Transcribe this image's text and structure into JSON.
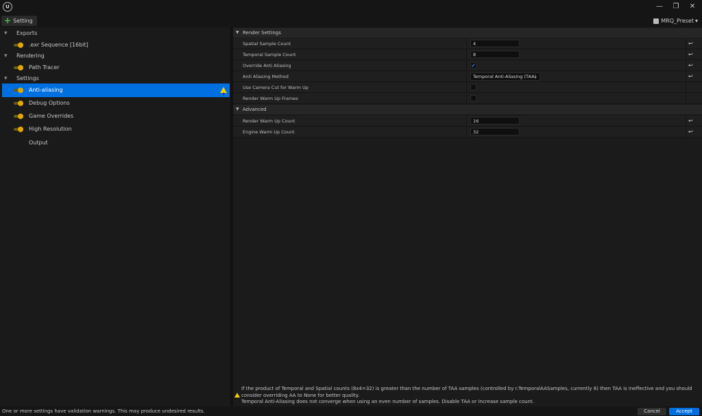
{
  "window": {
    "logo_text": "U",
    "minimize": "—",
    "restore": "❐",
    "close": "✕"
  },
  "toolbar": {
    "add_setting_label": "Setting",
    "preset_label": "MRQ_Preset",
    "preset_arrow": "▾"
  },
  "tree": {
    "exports_label": "Exports",
    "exr_label": ".exr Sequence [16bit]",
    "rendering_label": "Rendering",
    "path_tracer_label": "Path Tracer",
    "settings_label": "Settings",
    "anti_aliasing_label": "Anti-aliasing",
    "debug_options_label": "Debug Options",
    "game_overrides_label": "Game Overrides",
    "high_resolution_label": "High Resolution",
    "output_label": "Output",
    "warning_mark": "!"
  },
  "details": {
    "render_settings_header": "Render Settings",
    "spatial_sample_count_label": "Spatial Sample Count",
    "spatial_sample_count_value": "4",
    "temporal_sample_count_label": "Temporal Sample Count",
    "temporal_sample_count_value": "8",
    "override_aa_label": "Override Anti Aliasing",
    "override_aa_check": "✔",
    "aa_method_label": "Anti Aliasing Method",
    "aa_method_value": "Temporal Anti-Aliasing (TAA)",
    "dropdown_arrow": "⌄",
    "use_camera_cut_label": "Use Camera Cut for Warm Up",
    "render_warmup_frames_label": "Render Warm Up Frames",
    "advanced_header": "Advanced",
    "render_warmup_count_label": "Render Warm Up Count",
    "render_warmup_count_value": "16",
    "engine_warmup_count_label": "Engine Warm Up Count",
    "engine_warmup_count_value": "32",
    "reset_glyph": "↩",
    "caret_glyph": "▼"
  },
  "warning": {
    "line1": "If the product of Temporal and Spatial counts (8x4=32) is greater than the number of TAA samples (controlled by r.TemporalAASamples, currently 8) then TAA is ineffective and you should consider overriding AA to None for better quality.",
    "line2": "Temporal Anti-Aliasing does not converge when using an even number of samples. Disable TAA or increase sample count."
  },
  "status": {
    "message": "One or more settings have validation warnings. This may produce undesired results.",
    "cancel_label": "Cancel",
    "accept_label": "Accept"
  },
  "colors": {
    "accent": "#0070e0",
    "toggle": "#e0a800",
    "warning": "#f5d000"
  }
}
